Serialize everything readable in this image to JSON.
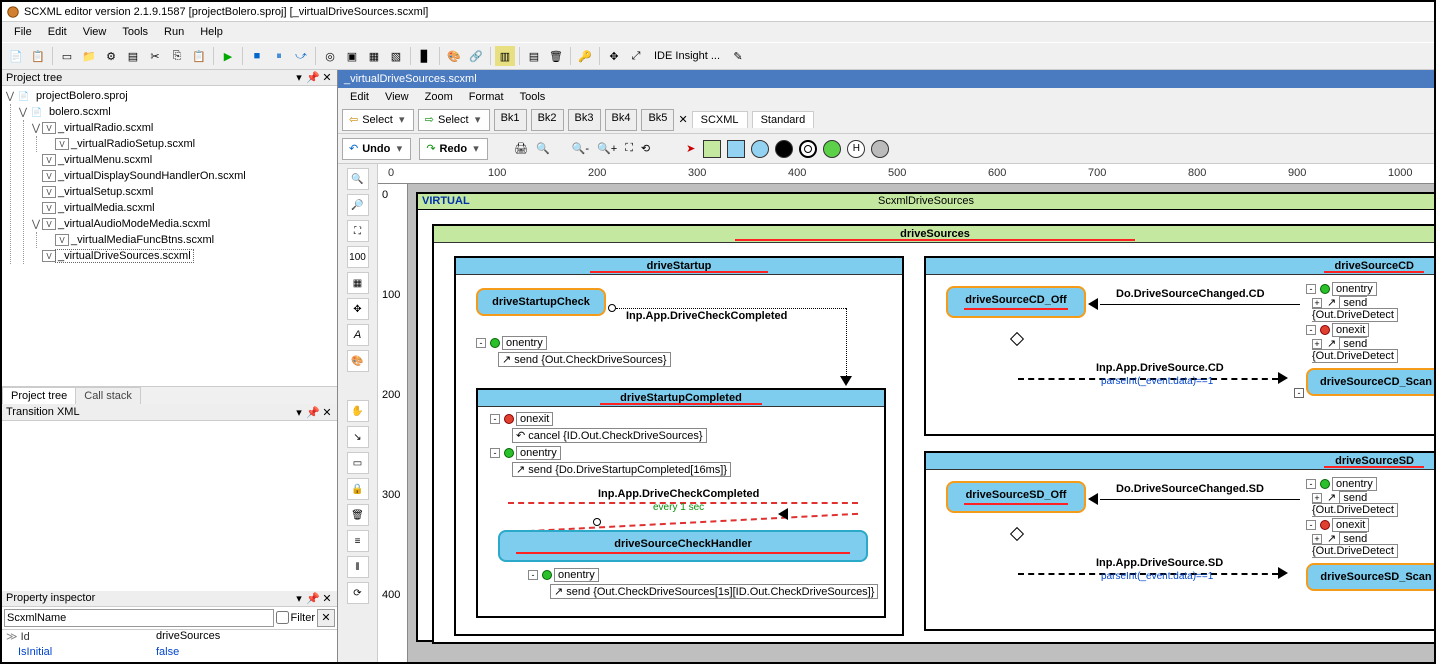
{
  "window": {
    "title": "SCXML editor version 2.1.9.1587 [projectBolero.sproj] [_virtualDriveSources.scxml]"
  },
  "menubar": [
    "File",
    "Edit",
    "View",
    "Tools",
    "Run",
    "Help"
  ],
  "ide_insight": "IDE Insight ...",
  "project_tree": {
    "title": "Project tree",
    "root": "projectBolero.sproj",
    "items": [
      {
        "label": "bolero.scxml",
        "depth": 1,
        "toggle": "v"
      },
      {
        "label": "_virtualRadio.scxml",
        "depth": 2,
        "toggle": "v"
      },
      {
        "label": "_virtualRadioSetup.scxml",
        "depth": 3
      },
      {
        "label": "_virtualMenu.scxml",
        "depth": 2
      },
      {
        "label": "_virtualDisplaySoundHandlerOn.scxml",
        "depth": 2
      },
      {
        "label": "_virtualSetup.scxml",
        "depth": 2
      },
      {
        "label": "_virtualMedia.scxml",
        "depth": 2
      },
      {
        "label": "_virtualAudioModeMedia.scxml",
        "depth": 2,
        "toggle": "v"
      },
      {
        "label": "_virtualMediaFuncBtns.scxml",
        "depth": 3
      },
      {
        "label": "_virtualDriveSources.scxml",
        "depth": 2,
        "sel": true
      }
    ]
  },
  "tabs_bottom_left": {
    "a": "Project tree",
    "b": "Call stack"
  },
  "transition_xml": {
    "title": "Transition XML"
  },
  "property_inspector": {
    "title": "Property inspector",
    "search": "ScxmlName",
    "filter": "Filter",
    "rows": [
      {
        "k": "Id",
        "v": "driveSources",
        "expand": true
      },
      {
        "k": "IsInitial",
        "v": "false",
        "link": true
      }
    ]
  },
  "doc": {
    "tab": "_virtualDriveSources.scxml",
    "submenu": [
      "Edit",
      "View",
      "Zoom",
      "Format",
      "Tools"
    ],
    "select_left": "Select",
    "select_right": "Select",
    "undo": "Undo",
    "redo": "Redo",
    "bks": [
      "Bk1",
      "Bk2",
      "Bk3",
      "Bk4",
      "Bk5"
    ],
    "palette_tabs": {
      "a": "SCXML",
      "b": "Standard"
    }
  },
  "ruler": {
    "h": [
      "0",
      "100",
      "200",
      "300",
      "400",
      "500",
      "600",
      "700",
      "800",
      "900",
      "1000"
    ],
    "v": [
      "0",
      "100",
      "200",
      "300",
      "400"
    ]
  },
  "diagram": {
    "virtual": "VIRTUAL",
    "topTitle": "ScxmlDriveSources",
    "driveSources": "driveSources",
    "driveStartup": "driveStartup",
    "driveStartupCheck": "driveStartupCheck",
    "onentry": "onentry",
    "onexit": "onexit",
    "send_checkDrive": "send {Out.CheckDriveSources}",
    "inpDriveCheck": "Inp.App.DriveCheckCompleted",
    "driveStartupCompleted": "driveStartupCompleted",
    "cancel": "cancel {ID.Out.CheckDriveSources}",
    "sendDoStartup": "send {Do.DriveStartupCompleted[16ms]}",
    "every1sec": "every 1 sec",
    "driveSourceCheckHandler": "driveSourceCheckHandler",
    "sendCheckDrive1s": "send {Out.CheckDriveSources[1s][ID.Out.CheckDriveSources]}",
    "driveSourceCD": "driveSourceCD",
    "driveSourceCD_Off": "driveSourceCD_Off",
    "doDriveSourceChangedCD": "Do.DriveSourceChanged.CD",
    "inpDriveSourceCD": "Inp.App.DriveSource.CD",
    "parseInt": "parseInt(_event.data)==1",
    "sendOutDriveDetect": "send {Out.DriveDetect",
    "driveSourceCD_Scan": "driveSourceCD_Scan",
    "driveSourceSD": "driveSourceSD",
    "driveSourceSD_Off": "driveSourceSD_Off",
    "doDriveSourceChangedSD": "Do.DriveSourceChanged.SD",
    "inpDriveSourceSD": "Inp.App.DriveSource.SD",
    "driveSourceSD_Scan": "driveSourceSD_Scan"
  }
}
